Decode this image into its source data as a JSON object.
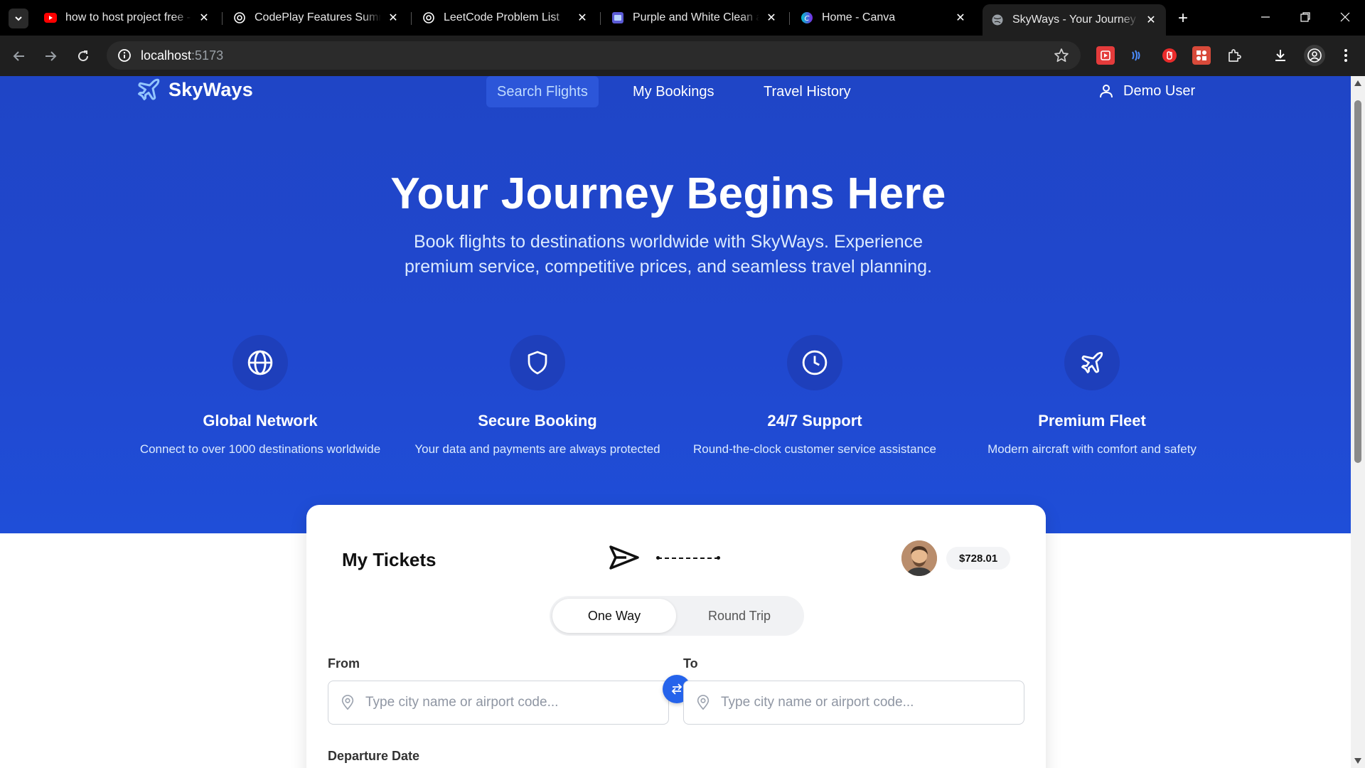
{
  "browser": {
    "tabs": [
      {
        "title": "how to host project free - YouTube",
        "icon": "youtube-icon",
        "active": false
      },
      {
        "title": "CodePlay Features Summary",
        "icon": "openai-icon",
        "active": false
      },
      {
        "title": "LeetCode Problem List",
        "icon": "openai-icon",
        "active": false
      },
      {
        "title": "Purple and White Clean and Minimal",
        "icon": "canva-doc-icon",
        "active": false
      },
      {
        "title": "Home - Canva",
        "icon": "canva-icon",
        "active": false
      },
      {
        "title": "SkyWays - Your Journey Begins Here",
        "icon": "globe-icon",
        "active": true
      }
    ],
    "url_host": "localhost",
    "url_port": ":5173"
  },
  "app": {
    "brand": "SkyWays",
    "nav": {
      "search": "Search Flights",
      "bookings": "My Bookings",
      "history": "Travel History"
    },
    "user": "Demo User"
  },
  "hero": {
    "title": "Your Journey Begins Here",
    "subtitle": "Book flights to destinations worldwide with SkyWays. Experience premium service, competitive prices, and seamless travel planning."
  },
  "features": [
    {
      "icon": "globe-icon",
      "title": "Global Network",
      "desc": "Connect to over 1000 destinations worldwide"
    },
    {
      "icon": "shield-icon",
      "title": "Secure Booking",
      "desc": "Your data and payments are always protected"
    },
    {
      "icon": "clock-icon",
      "title": "24/7 Support",
      "desc": "Round-the-clock customer service assistance"
    },
    {
      "icon": "plane-icon",
      "title": "Premium Fleet",
      "desc": "Modern aircraft with comfort and safety"
    }
  ],
  "tickets": {
    "title": "My Tickets",
    "price": "$728.01",
    "trip_types": {
      "one_way": "One Way",
      "round_trip": "Round Trip"
    },
    "selected_trip_type": "One Way",
    "from_label": "From",
    "to_label": "To",
    "from_placeholder": "Type city name or airport code...",
    "to_placeholder": "Type city name or airport code...",
    "departure_label": "Departure Date"
  },
  "colors": {
    "hero_blue": "#1f45c6",
    "accent_blue": "#2563eb"
  }
}
